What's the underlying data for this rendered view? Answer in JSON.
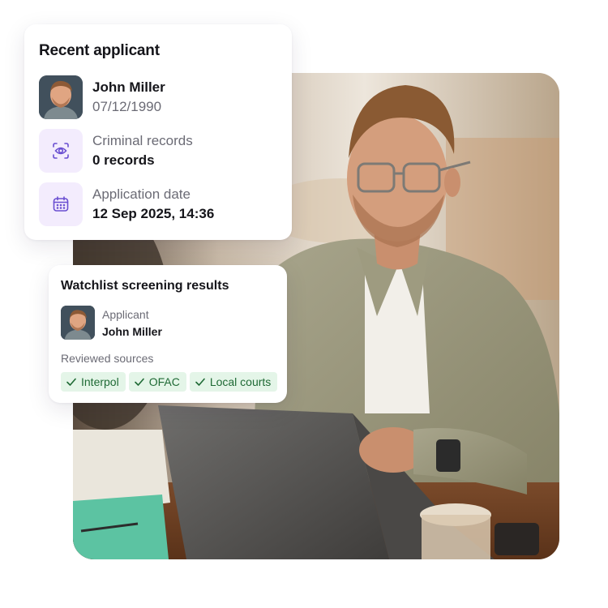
{
  "applicant_card": {
    "title": "Recent applicant",
    "name": "John Miller",
    "dob": "07/12/1990",
    "criminal_label": "Criminal records",
    "criminal_value": "0 records",
    "date_label": "Application date",
    "date_value": "12 Sep 2025, 14:36",
    "icons": [
      "avatar-photo",
      "eye-scan-icon",
      "calendar-icon"
    ]
  },
  "watchlist_card": {
    "title": "Watchlist screening results",
    "applicant_label": "Applicant",
    "applicant_name": "John Miller",
    "sources_label": "Reviewed sources",
    "sources": [
      "Interpol",
      "OFAC",
      "Local courts"
    ]
  },
  "colors": {
    "accent_purple": "#6a4fd1",
    "tile_bg": "#f3ecfd",
    "chip_bg": "#e4f5e8",
    "chip_text": "#1f6a35"
  }
}
